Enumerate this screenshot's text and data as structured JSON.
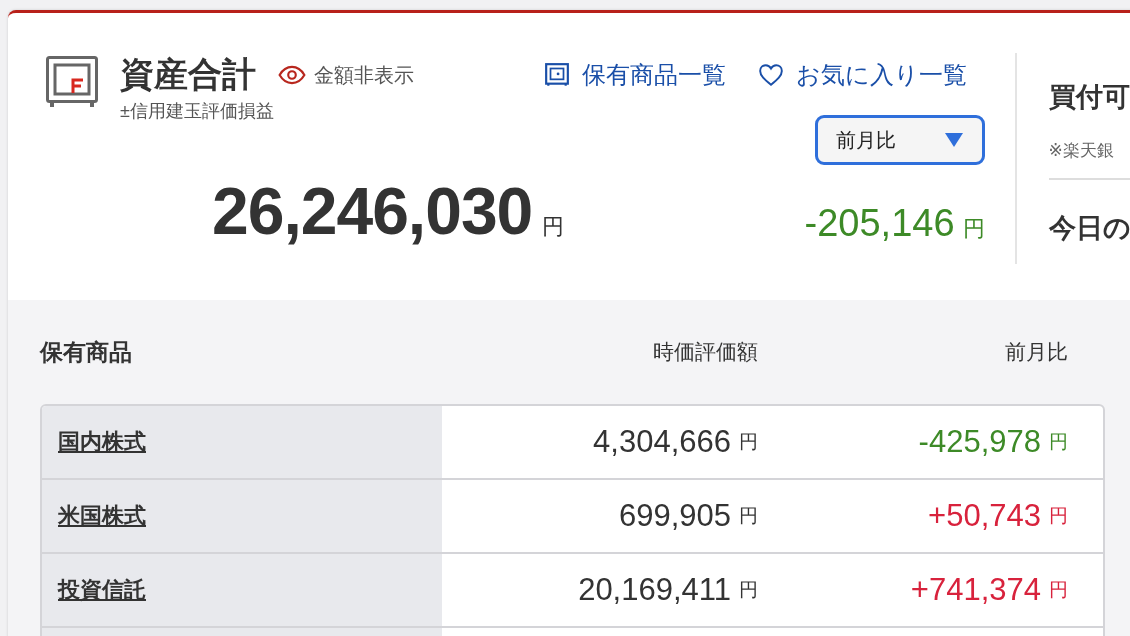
{
  "summary": {
    "title": "資産合計",
    "hide_amount": "金額非表示",
    "subtitle": "±信用建玉評価損益",
    "links": [
      {
        "kind": "holdings",
        "label": "保有商品一覧"
      },
      {
        "kind": "favorites",
        "label": "お気に入り一覧"
      }
    ],
    "period_select": {
      "value": "前月比"
    },
    "total": "26,246,030",
    "total_unit": "円",
    "change": {
      "value": "-205,146",
      "unit": "円",
      "color": "#3d8a27"
    }
  },
  "side_panel": {
    "title": "買付可",
    "note": "※楽天銀",
    "subtitle": "今日の"
  },
  "holdings": {
    "heading": "保有商品",
    "columns": [
      "時価評価額",
      "前月比"
    ],
    "rows": [
      {
        "name": "国内株式",
        "value": "4,304,666",
        "value_unit": "円",
        "change": "-425,978",
        "change_unit": "円",
        "color": "#3d8a27"
      },
      {
        "name": "米国株式",
        "value": "699,905",
        "value_unit": "円",
        "change": "+50,743",
        "change_unit": "円",
        "color": "#d8223c"
      },
      {
        "name": "投資信託",
        "value": "20,169,411",
        "value_unit": "円",
        "change": "+741,374",
        "change_unit": "円",
        "color": "#d8223c"
      }
    ]
  }
}
